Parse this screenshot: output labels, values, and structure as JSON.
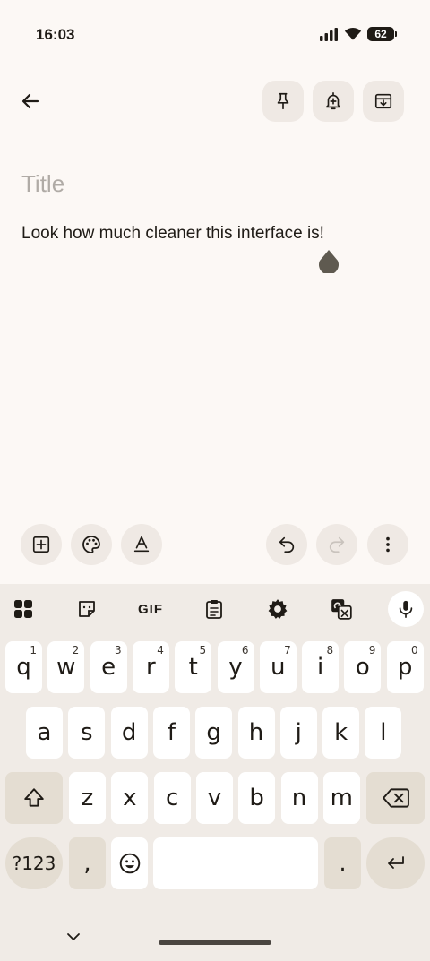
{
  "status_bar": {
    "time": "16:03",
    "battery": "62"
  },
  "note": {
    "title_placeholder": "Title",
    "body": "Look how much cleaner this interface is!"
  },
  "keyboard": {
    "gif_label": "GIF",
    "row1": [
      {
        "key": "q",
        "hint": "1"
      },
      {
        "key": "w",
        "hint": "2"
      },
      {
        "key": "e",
        "hint": "3"
      },
      {
        "key": "r",
        "hint": "4"
      },
      {
        "key": "t",
        "hint": "5"
      },
      {
        "key": "y",
        "hint": "6"
      },
      {
        "key": "u",
        "hint": "7"
      },
      {
        "key": "i",
        "hint": "8"
      },
      {
        "key": "o",
        "hint": "9"
      },
      {
        "key": "p",
        "hint": "0"
      }
    ],
    "row2": [
      "a",
      "s",
      "d",
      "f",
      "g",
      "h",
      "j",
      "k",
      "l"
    ],
    "row3": [
      "z",
      "x",
      "c",
      "v",
      "b",
      "n",
      "m"
    ],
    "symbols_label": "?123",
    "comma": ",",
    "period": "."
  }
}
